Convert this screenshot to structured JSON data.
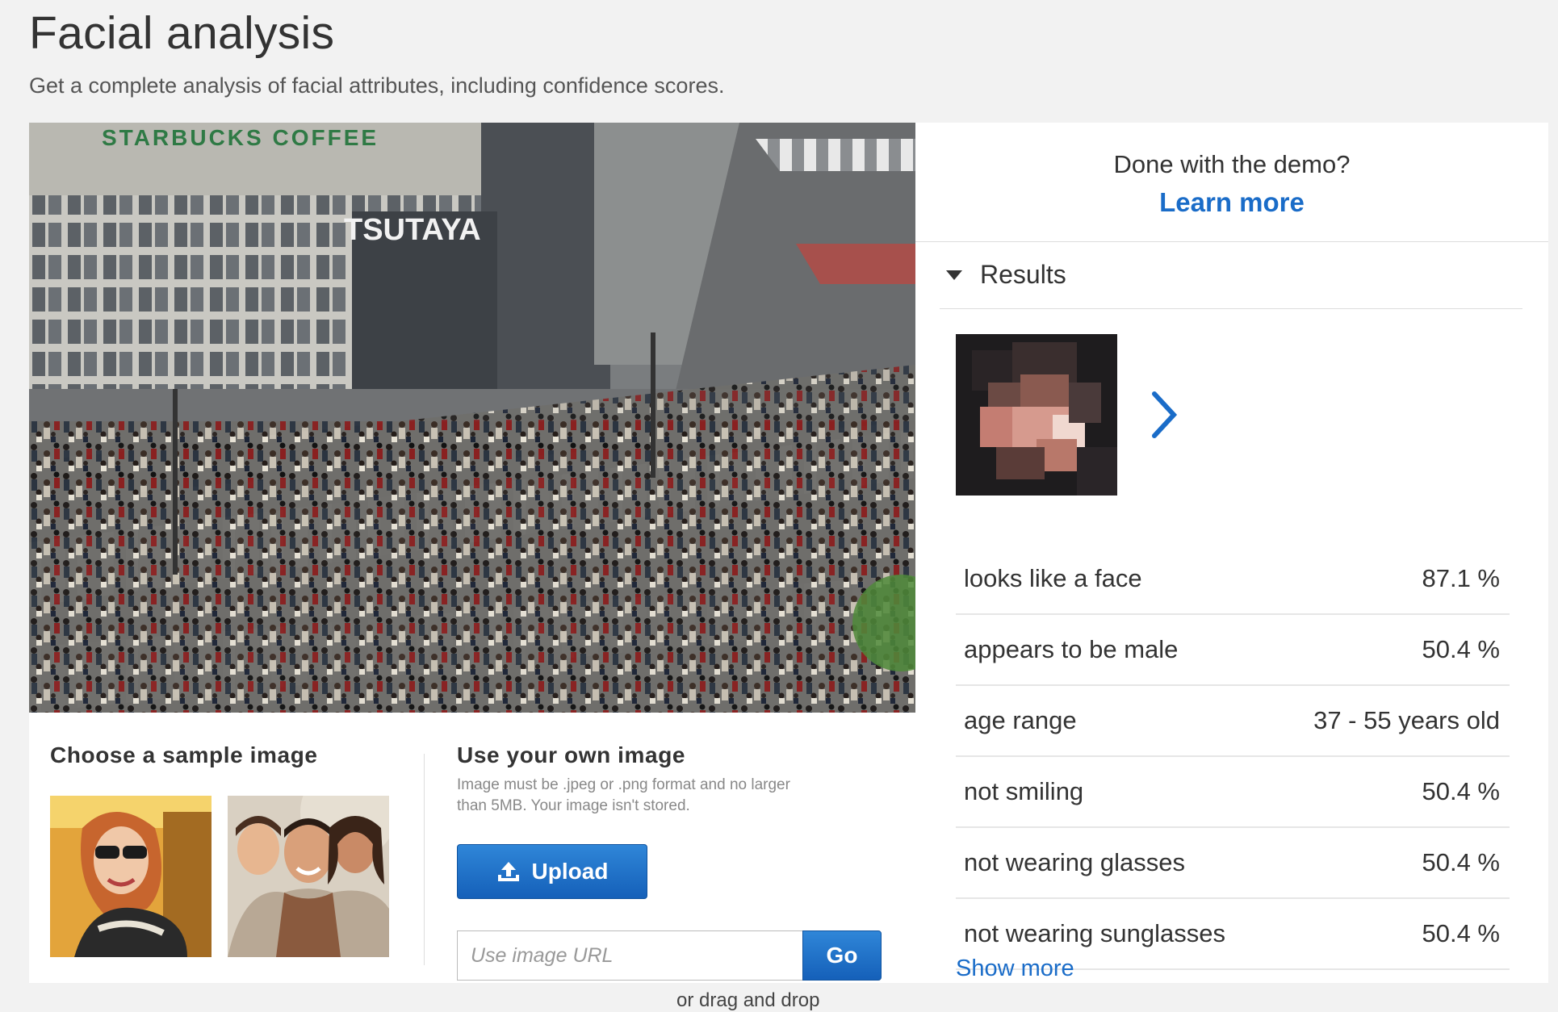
{
  "header": {
    "title": "Facial analysis",
    "subtitle": "Get a complete analysis of facial attributes, including confidence scores."
  },
  "scene": {
    "signs": [
      "STARBUCKS COFFEE",
      "TSUTAYA"
    ]
  },
  "samples": {
    "heading": "Choose a sample image"
  },
  "own_image": {
    "heading": "Use your own image",
    "note": "Image must be .jpeg or .png format and no larger than 5MB. Your image isn't stored.",
    "upload_label": "Upload",
    "drag_text": "or drag and drop",
    "url_placeholder": "Use image URL",
    "go_label": "Go"
  },
  "demo": {
    "question": "Done with the demo?",
    "learn_more": "Learn more"
  },
  "results": {
    "heading": "Results",
    "attributes": [
      {
        "label": "looks like a face",
        "value": "87.1 %"
      },
      {
        "label": "appears to be male",
        "value": "50.4 %"
      },
      {
        "label": "age range",
        "value": "37 - 55 years old"
      },
      {
        "label": "not smiling",
        "value": "50.4 %"
      },
      {
        "label": "not wearing glasses",
        "value": "50.4 %"
      },
      {
        "label": "not wearing sunglasses",
        "value": "50.4 %"
      }
    ],
    "show_more": "Show more"
  },
  "colors": {
    "accent": "#1a6cc8",
    "button_blue": "#1f6fc6",
    "page_bg": "#f2f2f2"
  }
}
